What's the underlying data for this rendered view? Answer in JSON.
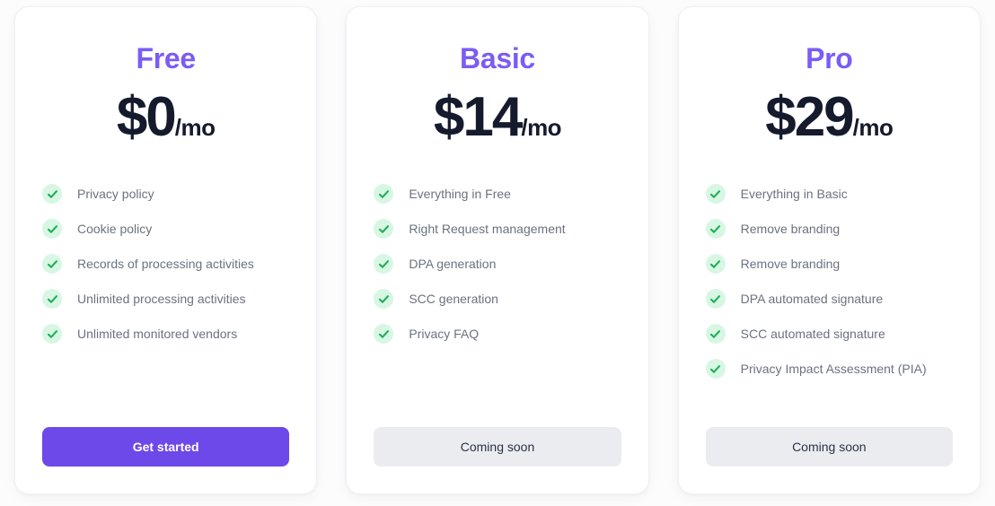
{
  "page": {
    "background_color": "#fcfcfd",
    "accent_color": "#7b5cf5",
    "primary_button_color": "#6c49e8",
    "check_badge_color": "#d7f7e4",
    "check_mark_color": "#1fae55",
    "price_color": "#151a2d",
    "feature_text_color": "#6b7280"
  },
  "plans": [
    {
      "name": "Free",
      "price": "$0",
      "period": "/mo",
      "features": [
        "Privacy policy",
        "Cookie policy",
        "Records of processing activities",
        "Unlimited processing activities",
        "Unlimited monitored vendors"
      ],
      "action": {
        "label": "Get started",
        "style": "primary"
      }
    },
    {
      "name": "Basic",
      "price": "$14",
      "period": "/mo",
      "features": [
        "Everything in Free",
        "Right Request management",
        "DPA generation",
        "SCC generation",
        "Privacy FAQ"
      ],
      "action": {
        "label": "Coming soon",
        "style": "muted"
      }
    },
    {
      "name": "Pro",
      "price": "$29",
      "period": "/mo",
      "features": [
        "Everything in Basic",
        "Remove branding",
        "Remove branding",
        "DPA automated signature",
        "SCC automated signature",
        "Privacy Impact Assessment (PIA)"
      ],
      "action": {
        "label": "Coming soon",
        "style": "muted"
      }
    }
  ]
}
